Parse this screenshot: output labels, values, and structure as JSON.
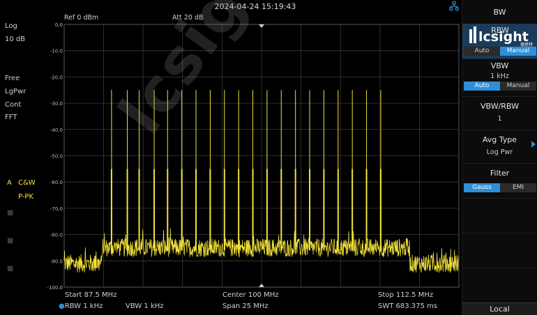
{
  "status_bar": {
    "timestamp": "2024-04-24 15:19:43"
  },
  "left_panel": {
    "scale_type": "Log",
    "scale_div": "10 dB",
    "sweep_mode": "Free",
    "detector": "LgPwr",
    "cont": "Cont",
    "fft": "FFT",
    "trace_a_letter": "A",
    "trace_a_type": "C&W",
    "trace_a_detector": "P-PK"
  },
  "header": {
    "ref_level": "Ref 0 dBm",
    "attenuation": "Att 20 dB"
  },
  "y_axis": {
    "ticks": [
      "0.0",
      "-10.0",
      "-20.0",
      "-30.0",
      "-40.0",
      "-50.0",
      "-60.0",
      "-70.0",
      "-80.0",
      "-90.0",
      "-100.0"
    ]
  },
  "footer": {
    "start": "Start 87.5 MHz",
    "center": "Center 100 MHz",
    "stop": "Stop 112.5 MHz",
    "rbw": "RBW 1 kHz",
    "vbw": "VBW 1 kHz",
    "span": "Span 25 MHz",
    "swt": "SWT 683.375 ms"
  },
  "right_panel": {
    "title": "BW",
    "rbw_label": "RBW",
    "rbw_auto": "Auto",
    "rbw_manual": "Manual",
    "vbw_label": "VBW",
    "vbw_value": "1 kHz",
    "vbw_auto": "Auto",
    "vbw_manual": "Manual",
    "ratio_label": "VBW/RBW",
    "ratio_value": "1",
    "avg_label": "Avg Type",
    "avg_value": "Log Pwr",
    "filter_label": "Filter",
    "filter_gauss": "Gauss",
    "filter_emi": "EMI",
    "local": "Local"
  },
  "logo": {
    "text": "lcsight",
    "subtext": "德思特"
  },
  "colors": {
    "trace": "#f2e33a",
    "accent": "#2e8fd6",
    "grid": "#3a3a3a"
  },
  "chart_data": {
    "type": "line",
    "xlim": [
      87.5,
      112.5
    ],
    "ylim": [
      -100,
      0
    ],
    "x_unit": "MHz",
    "y_unit": "dBm",
    "grid": true,
    "noise_floor": [
      {
        "from": 87.5,
        "to": 89.9,
        "level": -91
      },
      {
        "from": 89.9,
        "to": 109.4,
        "level": -85
      },
      {
        "from": 109.4,
        "to": 112.5,
        "level": -91
      }
    ],
    "tones": [
      {
        "f": 90.5,
        "peak": -25,
        "shoulder": -55
      },
      {
        "f": 91.5,
        "peak": -25,
        "shoulder": -55
      },
      {
        "f": 92.25,
        "peak": -25,
        "shoulder": -55
      },
      {
        "f": 93.2,
        "peak": -25,
        "shoulder": -55
      },
      {
        "f": 94.05,
        "peak": -25,
        "shoulder": -55
      },
      {
        "f": 94.95,
        "peak": -25,
        "shoulder": -55
      },
      {
        "f": 95.85,
        "peak": -25,
        "shoulder": -55
      },
      {
        "f": 96.75,
        "peak": -25,
        "shoulder": -55
      },
      {
        "f": 97.65,
        "peak": -25,
        "shoulder": -55
      },
      {
        "f": 98.55,
        "peak": -25,
        "shoulder": -55
      },
      {
        "f": 99.45,
        "peak": -25,
        "shoulder": -55
      },
      {
        "f": 100.35,
        "peak": -25,
        "shoulder": -55
      },
      {
        "f": 101.25,
        "peak": -25,
        "shoulder": -55
      },
      {
        "f": 102.15,
        "peak": -25,
        "shoulder": -55
      },
      {
        "f": 103.05,
        "peak": -25,
        "shoulder": -55
      },
      {
        "f": 103.95,
        "peak": -25,
        "shoulder": -55
      },
      {
        "f": 104.85,
        "peak": -25,
        "shoulder": -55
      },
      {
        "f": 105.75,
        "peak": -25,
        "shoulder": -55
      },
      {
        "f": 106.65,
        "peak": -25,
        "shoulder": -55
      },
      {
        "f": 107.55,
        "peak": -25,
        "shoulder": -55
      }
    ]
  }
}
